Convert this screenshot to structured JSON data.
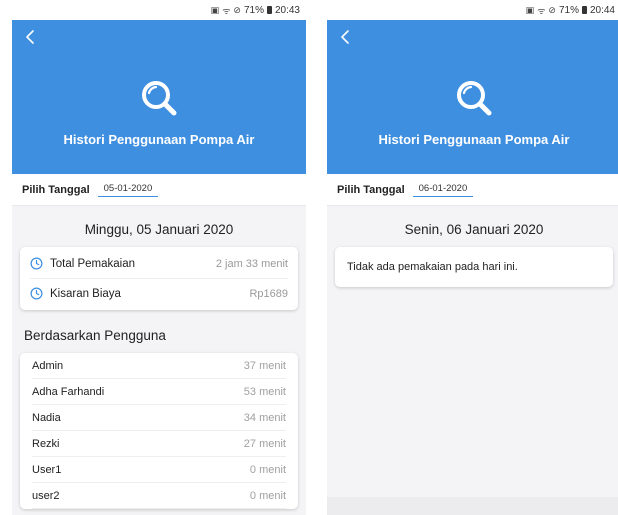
{
  "left": {
    "status": {
      "battery": "71%",
      "time": "20:43"
    },
    "header": {
      "title": "Histori Penggunaan Pompa Air"
    },
    "date_picker": {
      "label": "Pilih Tanggal",
      "value": "05-01-2020"
    },
    "day_heading": "Minggu, 05 Januari 2020",
    "summary": [
      {
        "label": "Total Pemakaian",
        "value": "2 jam 33 menit"
      },
      {
        "label": "Kisaran Biaya",
        "value": "Rp1689"
      }
    ],
    "section_title": "Berdasarkan Pengguna",
    "users": [
      {
        "name": "Admin",
        "value": "37 menit"
      },
      {
        "name": "Adha Farhandi",
        "value": "53 menit"
      },
      {
        "name": "Nadia",
        "value": "34 menit"
      },
      {
        "name": "Rezki",
        "value": "27 menit"
      },
      {
        "name": "User1",
        "value": "0 menit"
      },
      {
        "name": "user2",
        "value": "0 menit"
      }
    ]
  },
  "right": {
    "status": {
      "battery": "71%",
      "time": "20:44"
    },
    "header": {
      "title": "Histori Penggunaan Pompa Air"
    },
    "date_picker": {
      "label": "Pilih Tanggal",
      "value": "06-01-2020"
    },
    "day_heading": "Senin, 06 Januari 2020",
    "empty_message": "Tidak ada pemakaian pada hari ini."
  },
  "icons": {
    "back": "back-arrow-icon",
    "search": "search-icon",
    "clock": "clock-icon"
  },
  "colors": {
    "header_bg": "#3f8fe0",
    "accent": "#3f8fe0",
    "muted_text": "#9a9a9a",
    "page_bg": "#f4f4f6"
  }
}
